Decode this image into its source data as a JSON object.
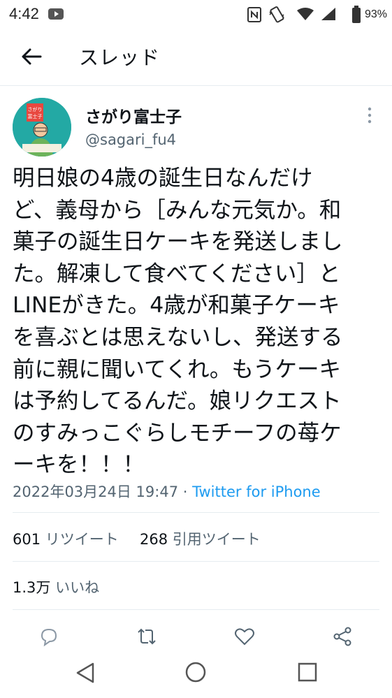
{
  "status": {
    "time": "4:42",
    "battery": "93%"
  },
  "header": {
    "title": "スレッド"
  },
  "tweet": {
    "author_name": "さがり富士子",
    "author_handle": "@sagari_fu4",
    "text": "明日娘の4歳の誕生日なんだけ\nど、義母から［みんな元気か。和\n菓子の誕生日ケーキを発送しまし\nた。解凍して食べてください］と\nLINEがきた。4歳が和菓子ケーキ\nを喜ぶとは思えないし、発送する\n前に親に聞いてくれ。もうケーキ\nは予約してるんだ。娘リクエスト\nのすみっこぐらしモチーフの苺ケ\nーキを！！！",
    "timestamp": "2022年03月24日 19:47",
    "separator": "·",
    "source": "Twitter for iPhone"
  },
  "stats": {
    "retweets": "601",
    "retweets_label": "リツイート",
    "quotes": "268",
    "quotes_label": "引用ツイート",
    "likes": "1.3万",
    "likes_label": "いいね"
  },
  "avatar_sign": {
    "line1": "さがり",
    "line2": "富士子"
  },
  "colors": {
    "accent": "#1d9bf0",
    "text": "#0f1419",
    "secondary": "#536471",
    "avatar_bg": "#23a9a4"
  }
}
